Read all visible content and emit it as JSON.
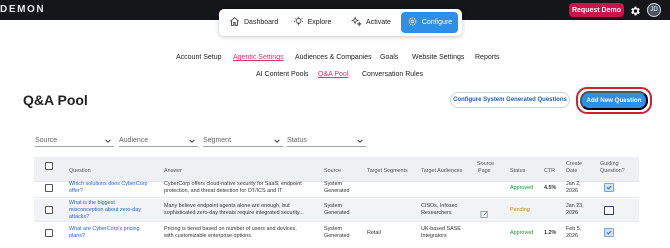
{
  "topbar": {
    "logo": "DEMON",
    "request_demo": "Request Demo",
    "avatar_initials": "JD"
  },
  "modules": {
    "dashboard": "Dashboard",
    "explore": "Explore",
    "activate": "Activate",
    "configure": "Configure"
  },
  "subnav": {
    "row1": [
      "Account Setup",
      "Agentic Settings",
      "Audiences & Companies",
      "Goals",
      "Website Settings",
      "Reports"
    ],
    "row2": [
      "AI Content Pools",
      "Q&A Pool",
      "Conversation Rules"
    ],
    "active_row1": "Agentic Settings",
    "active_row2": "Q&A Pool"
  },
  "page": {
    "title": "Q&A Pool",
    "configure_button": "Configure System Generated Questions",
    "add_button": "Add New Question"
  },
  "filters": {
    "source": "Source",
    "audience": "Audience",
    "segment": "Segment",
    "status": "Status"
  },
  "table": {
    "headers": {
      "question": "Question",
      "answer": "Answer",
      "source": "Source",
      "target_segments": "Target Segments",
      "target_audiences": "Target Audiences",
      "source_page_1": "Source",
      "source_page_2": "Page",
      "status": "Status",
      "ctr": "CTR",
      "create_1": "Create",
      "create_2": "Date",
      "guiding_1": "Guiding",
      "guiding_2": "Question?"
    },
    "rows": [
      {
        "q1": "Which solutions does CyberCorp",
        "q2": "offer?",
        "a1": "CyberCorp offers cloud-native security for SaaS, endpoint",
        "a2": "protection, and threat detection for OT/ICS and IT",
        "s1": "System",
        "s2": "Generated",
        "segment": "",
        "aud1": "",
        "aud2": "",
        "status": "Approved",
        "ctr": "4.5%",
        "d1": "Jan 2,",
        "d2": "2026",
        "guiding": true
      },
      {
        "q1": "What is the biggest",
        "q2": "misconception about zero-day",
        "q3": "attacks?",
        "a1": "Many believe endpoint agents alone are enough, but",
        "a2": "sophisticated zero-day threats require integrated security...",
        "s1": "System",
        "s2": "Generated",
        "segment": "",
        "aud1": "CISOs, Infosec",
        "aud2": "Researchers",
        "status": "Pending",
        "ctr": "",
        "d1": "Jan 23,",
        "d2": "2026",
        "guiding": false
      },
      {
        "q1": "What are CyberCorp's pricing",
        "q2": "plans?",
        "a1": "Pricing is tiered based on number of users and devices,",
        "a2": "with customizable enterprise options.",
        "s1": "System",
        "s2": "Generated",
        "segment": "Retail",
        "aud1": "UK-based SASE",
        "aud2": "Integrators",
        "status": "Approved",
        "ctr": "1.2%",
        "d1": "Feb 5,",
        "d2": "2026",
        "guiding": true
      }
    ]
  },
  "colors": {
    "brand_pink": "#c8154a",
    "accent_blue": "#2e8fe6",
    "highlight_red": "#d4202f",
    "approved_green": "#2a8b3b",
    "pending_amber": "#c88812"
  }
}
